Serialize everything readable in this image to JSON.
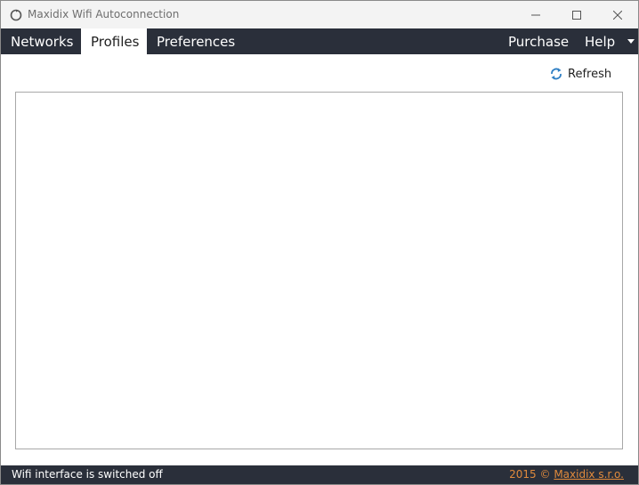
{
  "window": {
    "title": "Maxidix Wifi Autoconnection"
  },
  "menu": {
    "tabs": [
      {
        "label": "Networks"
      },
      {
        "label": "Profiles",
        "active": true
      },
      {
        "label": "Preferences"
      }
    ],
    "purchase_label": "Purchase",
    "help_label": "Help"
  },
  "toolbar": {
    "refresh_label": "Refresh"
  },
  "statusbar": {
    "status_text": "Wifi interface is switched off",
    "year": "2015 ©",
    "company": "Maxidix s.r.o."
  },
  "colors": {
    "menubar_bg": "#2a2f3a",
    "accent": "#e08a3c",
    "titlebar_bg": "#f3f3f3"
  },
  "icons": {
    "app": "circular-refresh-icon",
    "minimize": "minimize-icon",
    "maximize": "maximize-icon",
    "close": "close-icon",
    "refresh": "refresh-icon",
    "dropdown": "chevron-down-icon"
  }
}
